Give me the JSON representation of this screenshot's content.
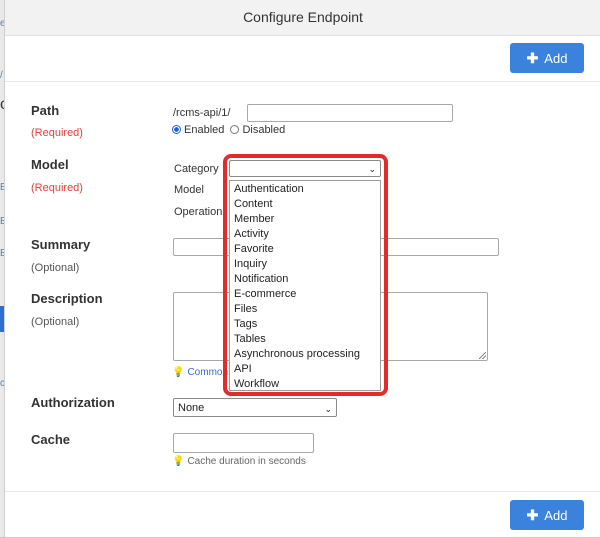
{
  "dialog": {
    "title": "Configure Endpoint",
    "add_label": "Add"
  },
  "path": {
    "label": "Path",
    "note": "(Required)",
    "prefix": "/rcms-api/1/",
    "value": "",
    "enabled_label": "Enabled",
    "disabled_label": "Disabled",
    "selected": "Enabled"
  },
  "model": {
    "label": "Model",
    "note": "(Required)",
    "category_label": "Category",
    "category_value": "",
    "model_label": "Model",
    "operation_label": "Operation",
    "options": [
      "Authentication",
      "Content",
      "Member",
      "Activity",
      "Favorite",
      "Inquiry",
      "Notification",
      "E-commerce",
      "Files",
      "Tags",
      "Tables",
      "Asynchronous processing",
      "API",
      "Workflow"
    ]
  },
  "summary": {
    "label": "Summary",
    "note": "(Optional)",
    "value": ""
  },
  "description": {
    "label": "Description",
    "note": "(Optional)",
    "value": "",
    "hint": "Common"
  },
  "authorization": {
    "label": "Authorization",
    "value": "None"
  },
  "cache": {
    "label": "Cache",
    "value": "",
    "hint": "Cache duration in seconds"
  },
  "colors": {
    "accent": "#3b82dc",
    "required": "#e0423b",
    "highlight": "#e22c2c"
  },
  "icons": {
    "add": "plus-icon",
    "hint": "lightbulb-icon",
    "select": "chevron-down-icon"
  }
}
